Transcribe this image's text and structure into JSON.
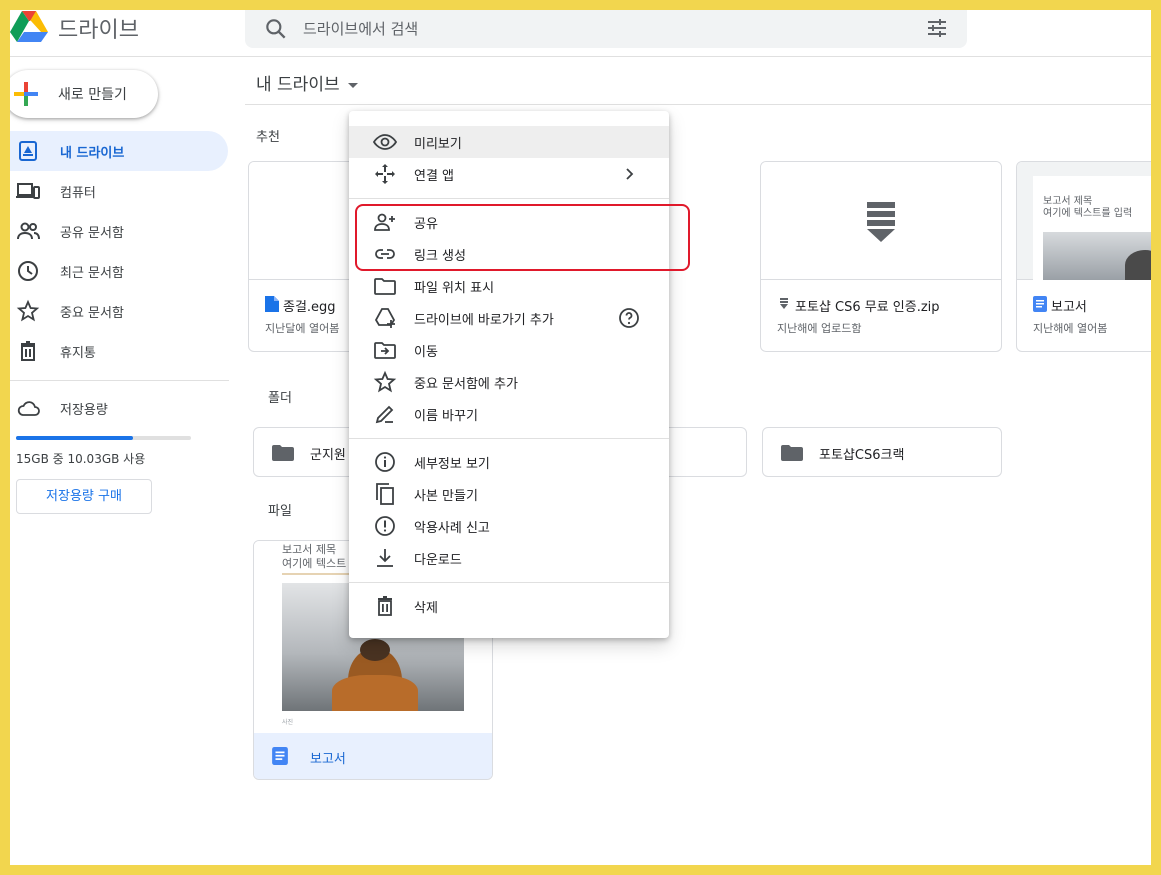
{
  "header": {
    "app_title": "드라이브",
    "search_placeholder": "드라이브에서 검색"
  },
  "sidebar": {
    "new_button": "새로 만들기",
    "items": [
      {
        "label": "내 드라이브",
        "icon": "my-drive-icon",
        "active": true
      },
      {
        "label": "컴퓨터",
        "icon": "computer-icon"
      },
      {
        "label": "공유 문서함",
        "icon": "shared-icon"
      },
      {
        "label": "최근 문서함",
        "icon": "clock-icon"
      },
      {
        "label": "중요 문서함",
        "icon": "star-icon"
      },
      {
        "label": "휴지통",
        "icon": "trash-icon"
      }
    ],
    "storage": {
      "label": "저장용량",
      "usage_text": "15GB 중 10.03GB 사용",
      "used_fraction": 0.67,
      "buy_button": "저장용량 구매"
    }
  },
  "main": {
    "title": "내 드라이브",
    "suggested_label": "추천",
    "suggested": [
      {
        "title": "종걸.egg",
        "subtitle": "지난달에 열어봄",
        "icon": "file-blue-icon"
      },
      {
        "title": "포토샵 CS6 무료 인증.zip",
        "subtitle": "지난해에 업로드함",
        "icon": "zip-icon"
      },
      {
        "title": "보고서",
        "subtitle": "지난해에 열어봄",
        "icon": "docs-icon",
        "thumb_title": "보고서 제목",
        "thumb_line": "여기에 텍스트를 입력"
      }
    ],
    "folders_label": "폴더",
    "folders": [
      {
        "name": "군지원"
      },
      {
        "name": "포토샵CS6크랙"
      }
    ],
    "files_label": "파일",
    "files": [
      {
        "name": "보고서",
        "thumb_title": "보고서 제목",
        "thumb_line": "여기에 텍스트",
        "thumb_caption": "사진"
      }
    ]
  },
  "context_menu": {
    "items": [
      {
        "label": "미리보기",
        "icon": "eye-icon"
      },
      {
        "label": "연결 앱",
        "icon": "open-with-icon"
      },
      {
        "label": "공유",
        "icon": "person-add-icon"
      },
      {
        "label": "링크 생성",
        "icon": "link-icon"
      },
      {
        "label": "파일 위치 표시",
        "icon": "folder-icon"
      },
      {
        "label": "드라이브에 바로가기 추가",
        "icon": "add-shortcut-icon"
      },
      {
        "label": "이동",
        "icon": "move-icon"
      },
      {
        "label": "중요 문서함에 추가",
        "icon": "star-icon"
      },
      {
        "label": "이름 바꾸기",
        "icon": "pencil-icon"
      },
      {
        "label": "세부정보 보기",
        "icon": "info-icon"
      },
      {
        "label": "사본 만들기",
        "icon": "copy-icon"
      },
      {
        "label": "악용사례 신고",
        "icon": "report-icon"
      },
      {
        "label": "다운로드",
        "icon": "download-icon"
      },
      {
        "label": "삭제",
        "icon": "trash-icon"
      }
    ]
  },
  "colors": {
    "accent": "#1a73e8",
    "active_bg": "#e8f0fe",
    "highlight_border": "#e0192b",
    "page_border": "#f2d64e"
  }
}
